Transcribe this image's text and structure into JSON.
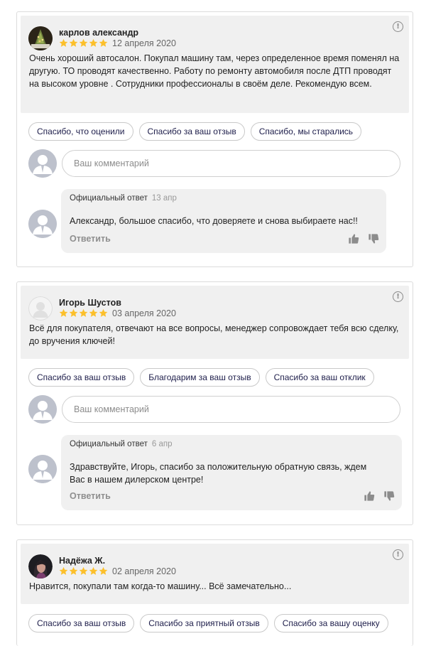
{
  "reviews": [
    {
      "author": "карлов александр",
      "date": "12 апреля 2020",
      "rating": 5,
      "text": "Очень хороший автосалон. Покупал машину там, через определенное время поменял на другую. ТО проводят качественно. Работу по ремонту автомобиля после ДТП проводят на высоком уровне . Сотрудники профессионалы в своём деле. Рекомендую всем.",
      "chips": [
        "Спасибо, что оценили",
        "Спасибо за ваш отзыв",
        "Спасибо, мы старались"
      ],
      "comment_placeholder": "Ваш комментарий",
      "reply": {
        "label": "Официальный ответ",
        "date": "13 апр",
        "text": "Александр, большое спасибо, что доверяете и снова выбираете нас!!",
        "reply_label": "Ответить"
      }
    },
    {
      "author": "Игорь Шустов",
      "date": "03 апреля 2020",
      "rating": 5,
      "text": "Всё для покупателя, отвечают на все вопросы, менеджер сопровождает тебя всю сделку, до вручения ключей!",
      "chips": [
        "Спасибо за ваш отзыв",
        "Благодарим за ваш отзыв",
        "Спасибо за ваш отклик"
      ],
      "comment_placeholder": "Ваш комментарий",
      "reply": {
        "label": "Официальный ответ",
        "date": "6 апр",
        "text": "Здравствуйте, Игорь,  спасибо за положительную обратную связь, ждем Вас в нашем дилерском центре!",
        "reply_label": "Ответить"
      }
    },
    {
      "author": "Надёжа Ж.",
      "date": "02 апреля 2020",
      "rating": 5,
      "text": "Нравится, покупали там когда-то машину... Всё замечательно...",
      "chips": [
        "Спасибо за ваш отзыв",
        "Спасибо за приятный отзыв",
        "Спасибо за вашу оценку"
      ]
    }
  ],
  "icons": {
    "report": "exclamation-circle-icon",
    "star": "star-icon",
    "like": "thumbs-up-icon",
    "dislike": "thumbs-down-icon"
  },
  "colors": {
    "star": "#fcc02c",
    "review_bg": "#f0f0f0",
    "chip_text": "#1d1d4a",
    "avatar_placeholder": "#bdc1cc"
  }
}
